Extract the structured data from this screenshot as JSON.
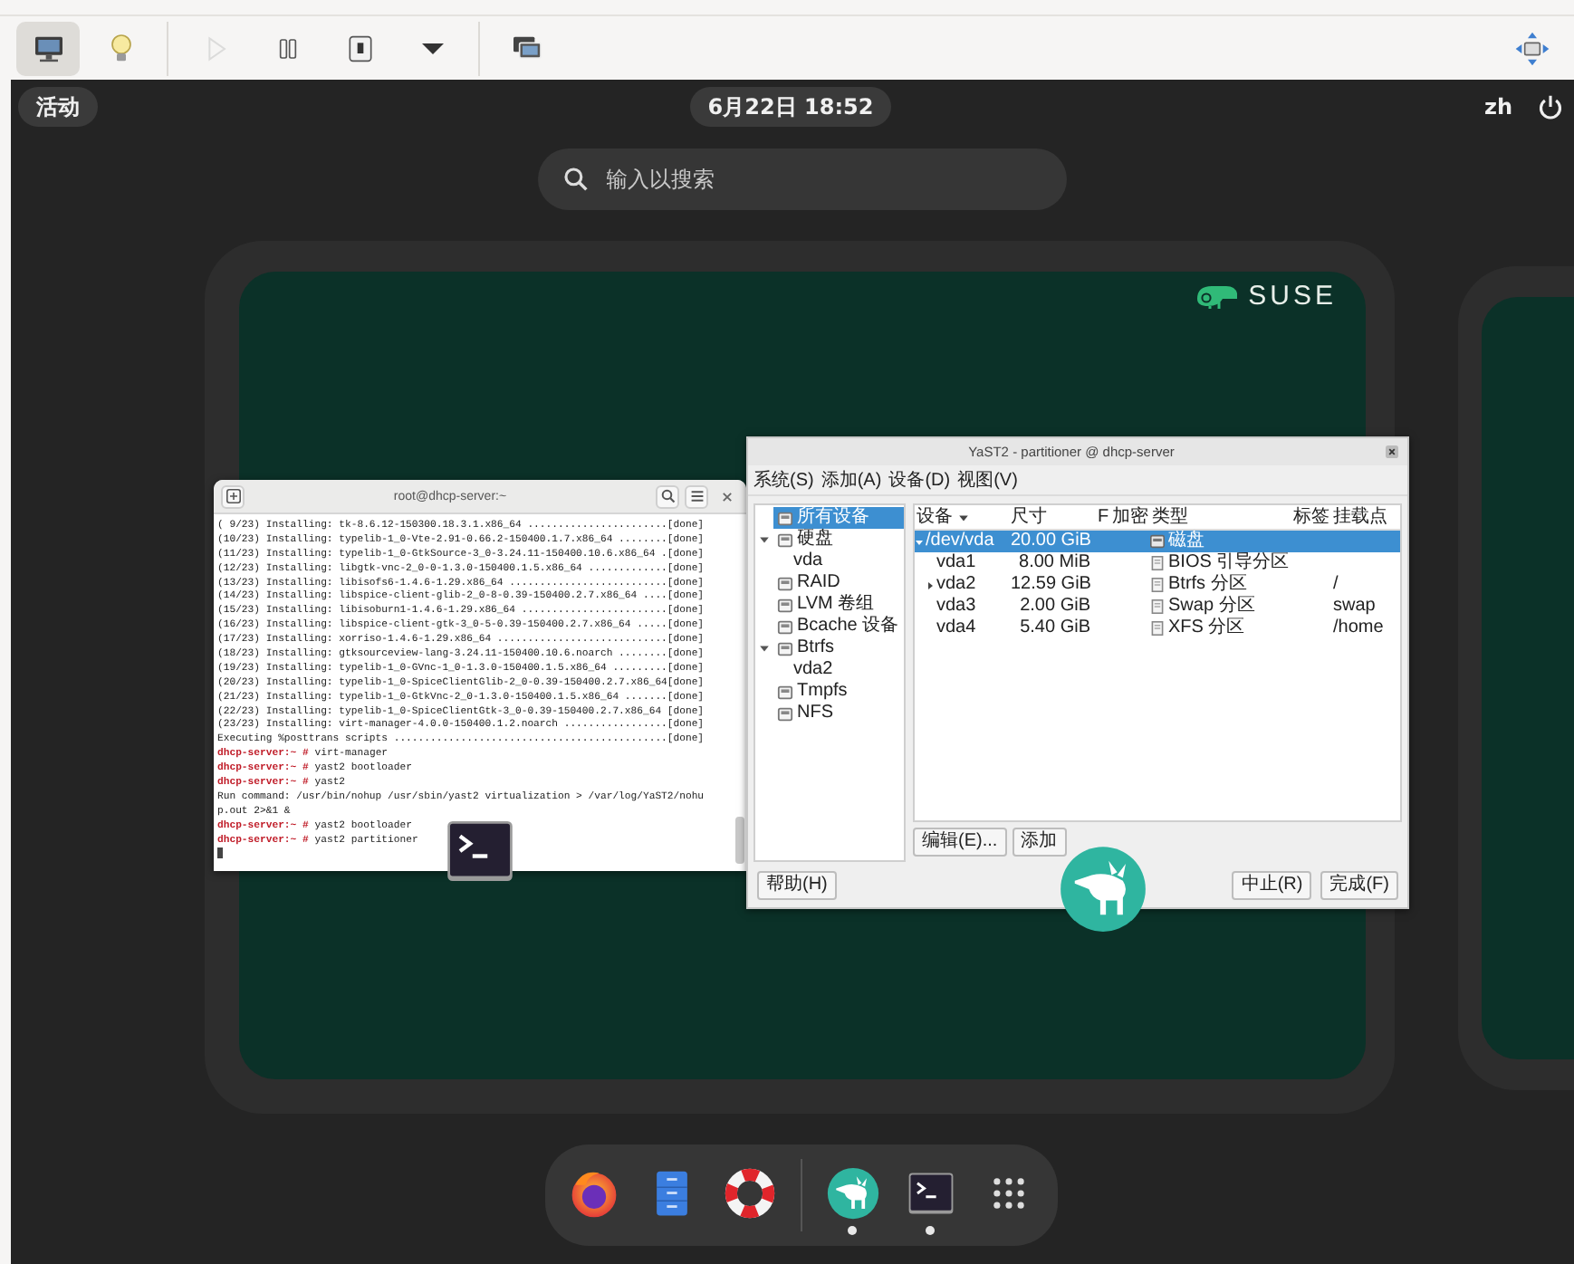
{
  "toolbar": {
    "groups": [
      {
        "buttons": [
          {
            "kind": "display",
            "selected": true,
            "disabled": false
          },
          {
            "kind": "details",
            "selected": false,
            "disabled": false
          }
        ]
      },
      {
        "buttons": [
          {
            "kind": "run",
            "selected": false,
            "disabled": true
          },
          {
            "kind": "pause",
            "selected": false,
            "disabled": false
          },
          {
            "kind": "shutdown",
            "selected": false,
            "disabled": false
          },
          {
            "kind": "menu",
            "selected": false,
            "disabled": false
          }
        ]
      },
      {
        "buttons": [
          {
            "kind": "snapshots",
            "selected": false,
            "disabled": false
          }
        ]
      }
    ],
    "right_buttons": [
      {
        "kind": "fullscreen"
      }
    ]
  },
  "top_bar": {
    "activities": "活动",
    "clock": "6月22日 18:52",
    "input_method": "zh"
  },
  "search": {
    "placeholder": "输入以搜索"
  },
  "workspace": {
    "logo": "SUSE",
    "windows": [
      {
        "kind": "terminal",
        "title": "root@dhcp-server:~",
        "lines": [
          {
            "kind": "output",
            "text": "( 9/23) Installing: tk-8.6.12-150300.18.3.1.x86_64 .......................[done]"
          },
          {
            "kind": "output",
            "text": "(10/23) Installing: typelib-1_0-Vte-2.91-0.66.2-150400.1.7.x86_64 ........[done]"
          },
          {
            "kind": "output",
            "text": "(11/23) Installing: typelib-1_0-GtkSource-3_0-3.24.11-150400.10.6.x86_64 .[done]"
          },
          {
            "kind": "output",
            "text": "(12/23) Installing: libgtk-vnc-2_0-0-1.3.0-150400.1.5.x86_64 .............[done]"
          },
          {
            "kind": "output",
            "text": "(13/23) Installing: libisofs6-1.4.6-1.29.x86_64 ..........................[done]"
          },
          {
            "kind": "output",
            "text": "(14/23) Installing: libspice-client-glib-2_0-8-0.39-150400.2.7.x86_64 ....[done]"
          },
          {
            "kind": "output",
            "text": "(15/23) Installing: libisoburn1-1.4.6-1.29.x86_64 ........................[done]"
          },
          {
            "kind": "output",
            "text": "(16/23) Installing: libspice-client-gtk-3_0-5-0.39-150400.2.7.x86_64 .....[done]"
          },
          {
            "kind": "output",
            "text": "(17/23) Installing: xorriso-1.4.6-1.29.x86_64 ............................[done]"
          },
          {
            "kind": "output",
            "text": "(18/23) Installing: gtksourceview-lang-3.24.11-150400.10.6.noarch ........[done]"
          },
          {
            "kind": "output",
            "text": "(19/23) Installing: typelib-1_0-GVnc-1_0-1.3.0-150400.1.5.x86_64 .........[done]"
          },
          {
            "kind": "output",
            "text": "(20/23) Installing: typelib-1_0-SpiceClientGlib-2_0-0.39-150400.2.7.x86_64[done]"
          },
          {
            "kind": "output",
            "text": "(21/23) Installing: typelib-1_0-GtkVnc-2_0-1.3.0-150400.1.5.x86_64 .......[done]"
          },
          {
            "kind": "output",
            "text": "(22/23) Installing: typelib-1_0-SpiceClientGtk-3_0-0.39-150400.2.7.x86_64 [done]"
          },
          {
            "kind": "output",
            "text": "(23/23) Installing: virt-manager-4.0.0-150400.1.2.noarch .................[done]"
          },
          {
            "kind": "output",
            "text": "Executing %posttrans scripts .............................................[done]"
          },
          {
            "kind": "prompt",
            "prompt": "dhcp-server:~ #",
            "command": "virt-manager"
          },
          {
            "kind": "prompt",
            "prompt": "dhcp-server:~ #",
            "command": "yast2 bootloader"
          },
          {
            "kind": "prompt",
            "prompt": "dhcp-server:~ #",
            "command": "yast2"
          },
          {
            "kind": "output",
            "text": "Run command: /usr/bin/nohup /usr/sbin/yast2 virtualization > /var/log/YaST2/nohu"
          },
          {
            "kind": "output",
            "text": "p.out 2>&1 &"
          },
          {
            "kind": "prompt",
            "prompt": "dhcp-server:~ #",
            "command": "yast2 bootloader"
          },
          {
            "kind": "prompt",
            "prompt": "dhcp-server:~ #",
            "command": "yast2 partitioner"
          },
          {
            "kind": "cursor"
          }
        ]
      },
      {
        "kind": "yast",
        "title": "YaST2 - partitioner @ dhcp-server",
        "menu": [
          "系统(S)",
          "添加(A)",
          "设备(D)",
          "视图(V)"
        ],
        "tree": [
          {
            "label": "所有设备",
            "selected": true
          },
          {
            "label": "硬盘",
            "selected": false,
            "expanded": true,
            "children": [
              {
                "label": "vda",
                "selected": false
              }
            ]
          },
          {
            "label": "RAID",
            "selected": false
          },
          {
            "label": "LVM 卷组",
            "selected": false
          },
          {
            "label": "Bcache 设备",
            "selected": false
          },
          {
            "label": "Btrfs",
            "selected": false,
            "expanded": true,
            "children": [
              {
                "label": "vda2",
                "selected": false
              }
            ]
          },
          {
            "label": "Tmpfs",
            "selected": false
          },
          {
            "label": "NFS",
            "selected": false
          }
        ],
        "table": {
          "columns": [
            {
              "label": "设备",
              "sorted": true
            },
            {
              "label": "尺寸",
              "sorted": false
            },
            {
              "label": "F",
              "sorted": false
            },
            {
              "label": "加密",
              "sorted": false
            },
            {
              "label": "类型",
              "sorted": false
            },
            {
              "label": "标签",
              "sorted": false
            },
            {
              "label": "挂载点",
              "sorted": false
            }
          ],
          "rows": [
            {
              "device": "/dev/vda",
              "size": "20.00 GiB",
              "type": "磁盘",
              "selected": true,
              "expanded": true,
              "children": [
                {
                  "device": "vda1",
                  "size": "8.00 MiB",
                  "type": "BIOS 引导分区",
                  "selected": false
                },
                {
                  "device": "vda2",
                  "size": "12.59 GiB",
                  "type": "Btrfs 分区",
                  "mount": "/",
                  "selected": false,
                  "expanded": false
                },
                {
                  "device": "vda3",
                  "size": "2.00 GiB",
                  "type": "Swap 分区",
                  "mount": "swap",
                  "selected": false
                },
                {
                  "device": "vda4",
                  "size": "5.40 GiB",
                  "type": "XFS 分区",
                  "mount": "/home",
                  "selected": false
                }
              ]
            }
          ]
        },
        "table_buttons": [
          "编辑(E)...",
          "添加"
        ],
        "buttons_left": [
          "帮助(H)"
        ],
        "buttons_right": [
          "中止(R)",
          "完成(F)"
        ]
      }
    ]
  },
  "dock": {
    "groups": [
      {
        "items": [
          {
            "kind": "browser",
            "running": false
          },
          {
            "kind": "files",
            "running": false
          },
          {
            "kind": "help",
            "running": false
          }
        ]
      },
      {
        "items": [
          {
            "kind": "yast",
            "running": true
          },
          {
            "kind": "terminal",
            "running": true
          },
          {
            "kind": "apps",
            "running": false
          }
        ]
      }
    ]
  }
}
